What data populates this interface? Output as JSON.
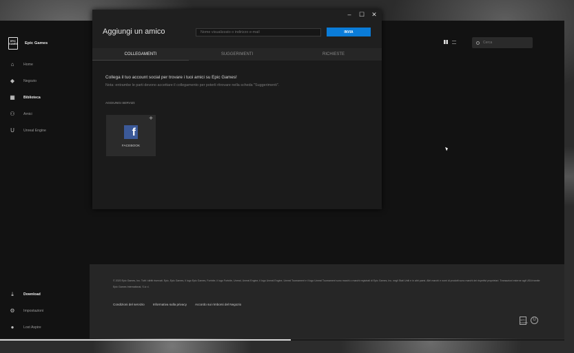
{
  "launcher": {
    "window_controls": [
      "–",
      "☐",
      "✕"
    ],
    "brand": {
      "logo_text": "EPIC GAMES",
      "name": "Epic Games"
    },
    "nav": [
      {
        "label": "Home",
        "icon": "home-icon",
        "active": false
      },
      {
        "label": "Negozio",
        "icon": "tag-icon",
        "active": false
      },
      {
        "label": "Biblioteca",
        "icon": "grid-icon",
        "active": true
      },
      {
        "label": "Amici",
        "icon": "friends-icon",
        "active": false
      },
      {
        "label": "Unreal Engine",
        "icon": "unreal-icon",
        "active": false
      }
    ],
    "bottom_nav": [
      {
        "label": "Download",
        "icon": "download-icon",
        "active": true
      },
      {
        "label": "Impostazioni",
        "icon": "gear-icon",
        "active": false
      },
      {
        "label": "Lost Aspire",
        "icon": "user-icon",
        "active": false
      }
    ],
    "search_placeholder": "Cerca",
    "footer": {
      "legal": "© 2020 Epic Games, Inc. Tutti i diritti riservati. Epic, Epic Games, il logo Epic Games, Fortnite, il logo Fortnite, Unreal, Unreal Engine, il logo Unreal Engine, Unreal Tournament e il logo Unreal Tournament sono marchi o marchi registrati di Epic Games, Inc. negli Stati Uniti e in altri paesi. Altri marchi e nomi di prodotti sono marchi dei rispettivi proprietari. Transazioni esterne agli USA tramite Epic Games International, S.à r.l.",
      "links": [
        "Condizioni del servizio",
        "Informativa sulla privacy",
        "Accordo sui rimborsi del Negozio"
      ]
    },
    "download_progress": 0.515
  },
  "dialog": {
    "window_controls": [
      "–",
      "☐",
      "✕"
    ],
    "title": "Aggiungi un amico",
    "input_placeholder": "Nome visualizzato o indirizzo e-mail",
    "send_label": "INVIA",
    "tabs": [
      {
        "label": "COLLEGAMENTI",
        "active": true
      },
      {
        "label": "SUGGERIMENTI",
        "active": false
      },
      {
        "label": "RICHIESTE",
        "active": false
      }
    ],
    "heading": "Collega il tuo account social per trovare i tuoi amici su Epic Games!",
    "note": "Nota: entrambe le parti devono accettare il collegamento per poterli ritrovare nella scheda \"Suggerimenti\".",
    "services_label": "AGGIUNGI SERVIZI:",
    "service": {
      "name": "FACEBOOK",
      "icon": "facebook-icon",
      "color": "#3b5998"
    }
  }
}
